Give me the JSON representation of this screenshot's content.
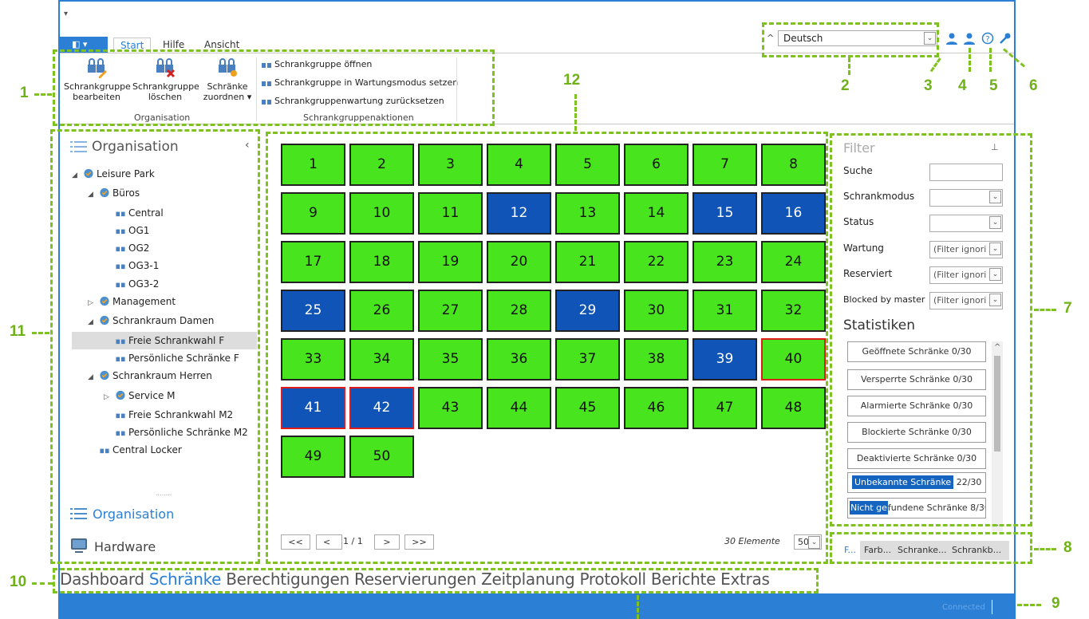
{
  "qat": "▾",
  "tabs": [
    "Start",
    "Hilfe",
    "Ansicht"
  ],
  "file_glyph": "◧ ▾",
  "ribbon": {
    "edit": [
      "Schrankgruppe",
      "bearbeiten"
    ],
    "delete": [
      "Schrankgruppe",
      "löschen"
    ],
    "assign": [
      "Schränke",
      "zuordnen ▾"
    ],
    "group_org": "Organisation",
    "open": "Schrankgruppe öffnen",
    "maint": "Schrankgruppe in Wartungsmodus setzen",
    "reset": "Schrankgruppenwartung zurücksetzen",
    "group_actions": "Schrankgruppenaktionen"
  },
  "language": "Deutsch",
  "callouts": {
    "c1": "1",
    "c2": "2",
    "c3": "3",
    "c4": "4",
    "c5": "5",
    "c6": "6",
    "c7": "7",
    "c8": "8",
    "c9": "9",
    "c10": "10",
    "c11": "11",
    "c12": "12"
  },
  "sidebar": {
    "title": "Organisation",
    "collapse": "‹",
    "tree": [
      "Leisure Park",
      "Büros",
      "Central",
      "OG1",
      "OG2",
      "OG3-1",
      "OG3-2",
      "Management",
      "Schrankraum Damen",
      "Freie Schrankwahl F",
      "Persönliche Schränke F",
      "Schrankraum Herren",
      "Service M",
      "Freie Schrankwahl M2",
      "Persönliche Schränke M2",
      "Central Locker"
    ],
    "dots": "........",
    "nav_org": "Organisation",
    "nav_hw": "Hardware"
  },
  "lockers": [
    {
      "n": "1",
      "c": "g"
    },
    {
      "n": "2",
      "c": "g"
    },
    {
      "n": "3",
      "c": "g"
    },
    {
      "n": "4",
      "c": "g"
    },
    {
      "n": "5",
      "c": "g"
    },
    {
      "n": "6",
      "c": "g"
    },
    {
      "n": "7",
      "c": "g"
    },
    {
      "n": "8",
      "c": "g"
    },
    {
      "n": "9",
      "c": "g"
    },
    {
      "n": "10",
      "c": "g"
    },
    {
      "n": "11",
      "c": "g"
    },
    {
      "n": "12",
      "c": "b"
    },
    {
      "n": "13",
      "c": "g"
    },
    {
      "n": "14",
      "c": "g"
    },
    {
      "n": "15",
      "c": "b"
    },
    {
      "n": "16",
      "c": "b"
    },
    {
      "n": "17",
      "c": "g"
    },
    {
      "n": "18",
      "c": "g"
    },
    {
      "n": "19",
      "c": "g"
    },
    {
      "n": "20",
      "c": "g"
    },
    {
      "n": "21",
      "c": "g"
    },
    {
      "n": "22",
      "c": "g"
    },
    {
      "n": "23",
      "c": "g"
    },
    {
      "n": "24",
      "c": "g"
    },
    {
      "n": "25",
      "c": "b"
    },
    {
      "n": "26",
      "c": "g"
    },
    {
      "n": "27",
      "c": "g"
    },
    {
      "n": "28",
      "c": "g"
    },
    {
      "n": "29",
      "c": "b"
    },
    {
      "n": "30",
      "c": "g"
    },
    {
      "n": "31",
      "c": "g"
    },
    {
      "n": "32",
      "c": "g"
    },
    {
      "n": "33",
      "c": "g"
    },
    {
      "n": "34",
      "c": "g"
    },
    {
      "n": "35",
      "c": "g"
    },
    {
      "n": "36",
      "c": "g"
    },
    {
      "n": "37",
      "c": "g"
    },
    {
      "n": "38",
      "c": "g"
    },
    {
      "n": "39",
      "c": "b"
    },
    {
      "n": "40",
      "c": "g r"
    },
    {
      "n": "41",
      "c": "b r"
    },
    {
      "n": "42",
      "c": "b r"
    },
    {
      "n": "43",
      "c": "g"
    },
    {
      "n": "44",
      "c": "g"
    },
    {
      "n": "45",
      "c": "g"
    },
    {
      "n": "46",
      "c": "g"
    },
    {
      "n": "47",
      "c": "g"
    },
    {
      "n": "48",
      "c": "g"
    },
    {
      "n": "49",
      "c": "g"
    },
    {
      "n": "50",
      "c": "g"
    }
  ],
  "pager": {
    "first": "<<",
    "prev": "<",
    "page": "1 / 1",
    "next": ">",
    "last": ">>",
    "count": "30 Elemente",
    "size": "50"
  },
  "filter": {
    "title": "Filter",
    "pin": "⊥",
    "suche": "Suche",
    "mode": "Schrankmodus",
    "status": "Status",
    "wartung": "Wartung",
    "reserviert": "Reserviert",
    "blocked": "Blocked by master",
    "ignore": "(Filter ignori",
    "dd": "⌄"
  },
  "stats": {
    "title": "Statistiken",
    "items": [
      "Geöffnete Schränke 0/30",
      "Versperrte Schränke 0/30",
      "Alarmierte Schränke 0/30",
      "Blockierte Schränke 0/30",
      "Deaktivierte Schränke 0/30"
    ],
    "unk_hl": "Unbekannte Schränke",
    "unk_rest": " 22/30",
    "nf_hl": "Nicht ge",
    "nf_rest": "fundene Schränke 8/30",
    "up": "^",
    "down": "⌄"
  },
  "bottom_tabs": [
    "F...",
    "Farb...",
    "Schranke...",
    "Schrankb..."
  ],
  "main_nav": [
    "Dashboard",
    "Schränke",
    "Berechtigungen",
    "Reservierungen",
    "Zeitplanung",
    "Protokoll",
    "Berichte",
    "Extras"
  ],
  "status": "Connected",
  "colors": {
    "accent": "#2b7fd4",
    "green": "#48e41e",
    "blue": "#0f54b6",
    "callout": "#7dc21e"
  }
}
